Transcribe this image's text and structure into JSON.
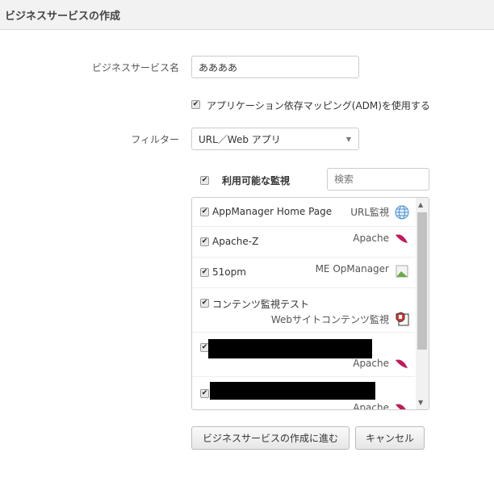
{
  "header": {
    "title": "ビジネスサービスの作成"
  },
  "form": {
    "name_label": "ビジネスサービス名",
    "name_value": "ああああ",
    "adm_label": "アプリケーション依存マッピング(ADM)を使用する",
    "adm_checked": true,
    "filter_label": "フィルター",
    "filter_value": "URL／Web アプリ",
    "monitors_label": "利用可能な監視",
    "search_placeholder": "検索"
  },
  "monitors": [
    {
      "name": "AppManager Home Page",
      "type": "URL監視",
      "icon": "globe-icon"
    },
    {
      "name": "Apache-Z",
      "type": "Apache",
      "icon": "feather-icon"
    },
    {
      "name": "51opm",
      "type": "ME OpManager",
      "icon": "broken-image-icon"
    },
    {
      "name": "コンテンツ監視テスト",
      "type": "Webサイトコンテンツ監視",
      "icon": "shield-icon"
    },
    {
      "name": "",
      "type": "Apache",
      "icon": "feather-icon"
    },
    {
      "name": "",
      "type": "Apache",
      "icon": "feather-icon"
    }
  ],
  "buttons": {
    "create": "ビジネスサービスの作成に進む",
    "cancel": "キャンセル"
  },
  "check_glyph": "✔"
}
